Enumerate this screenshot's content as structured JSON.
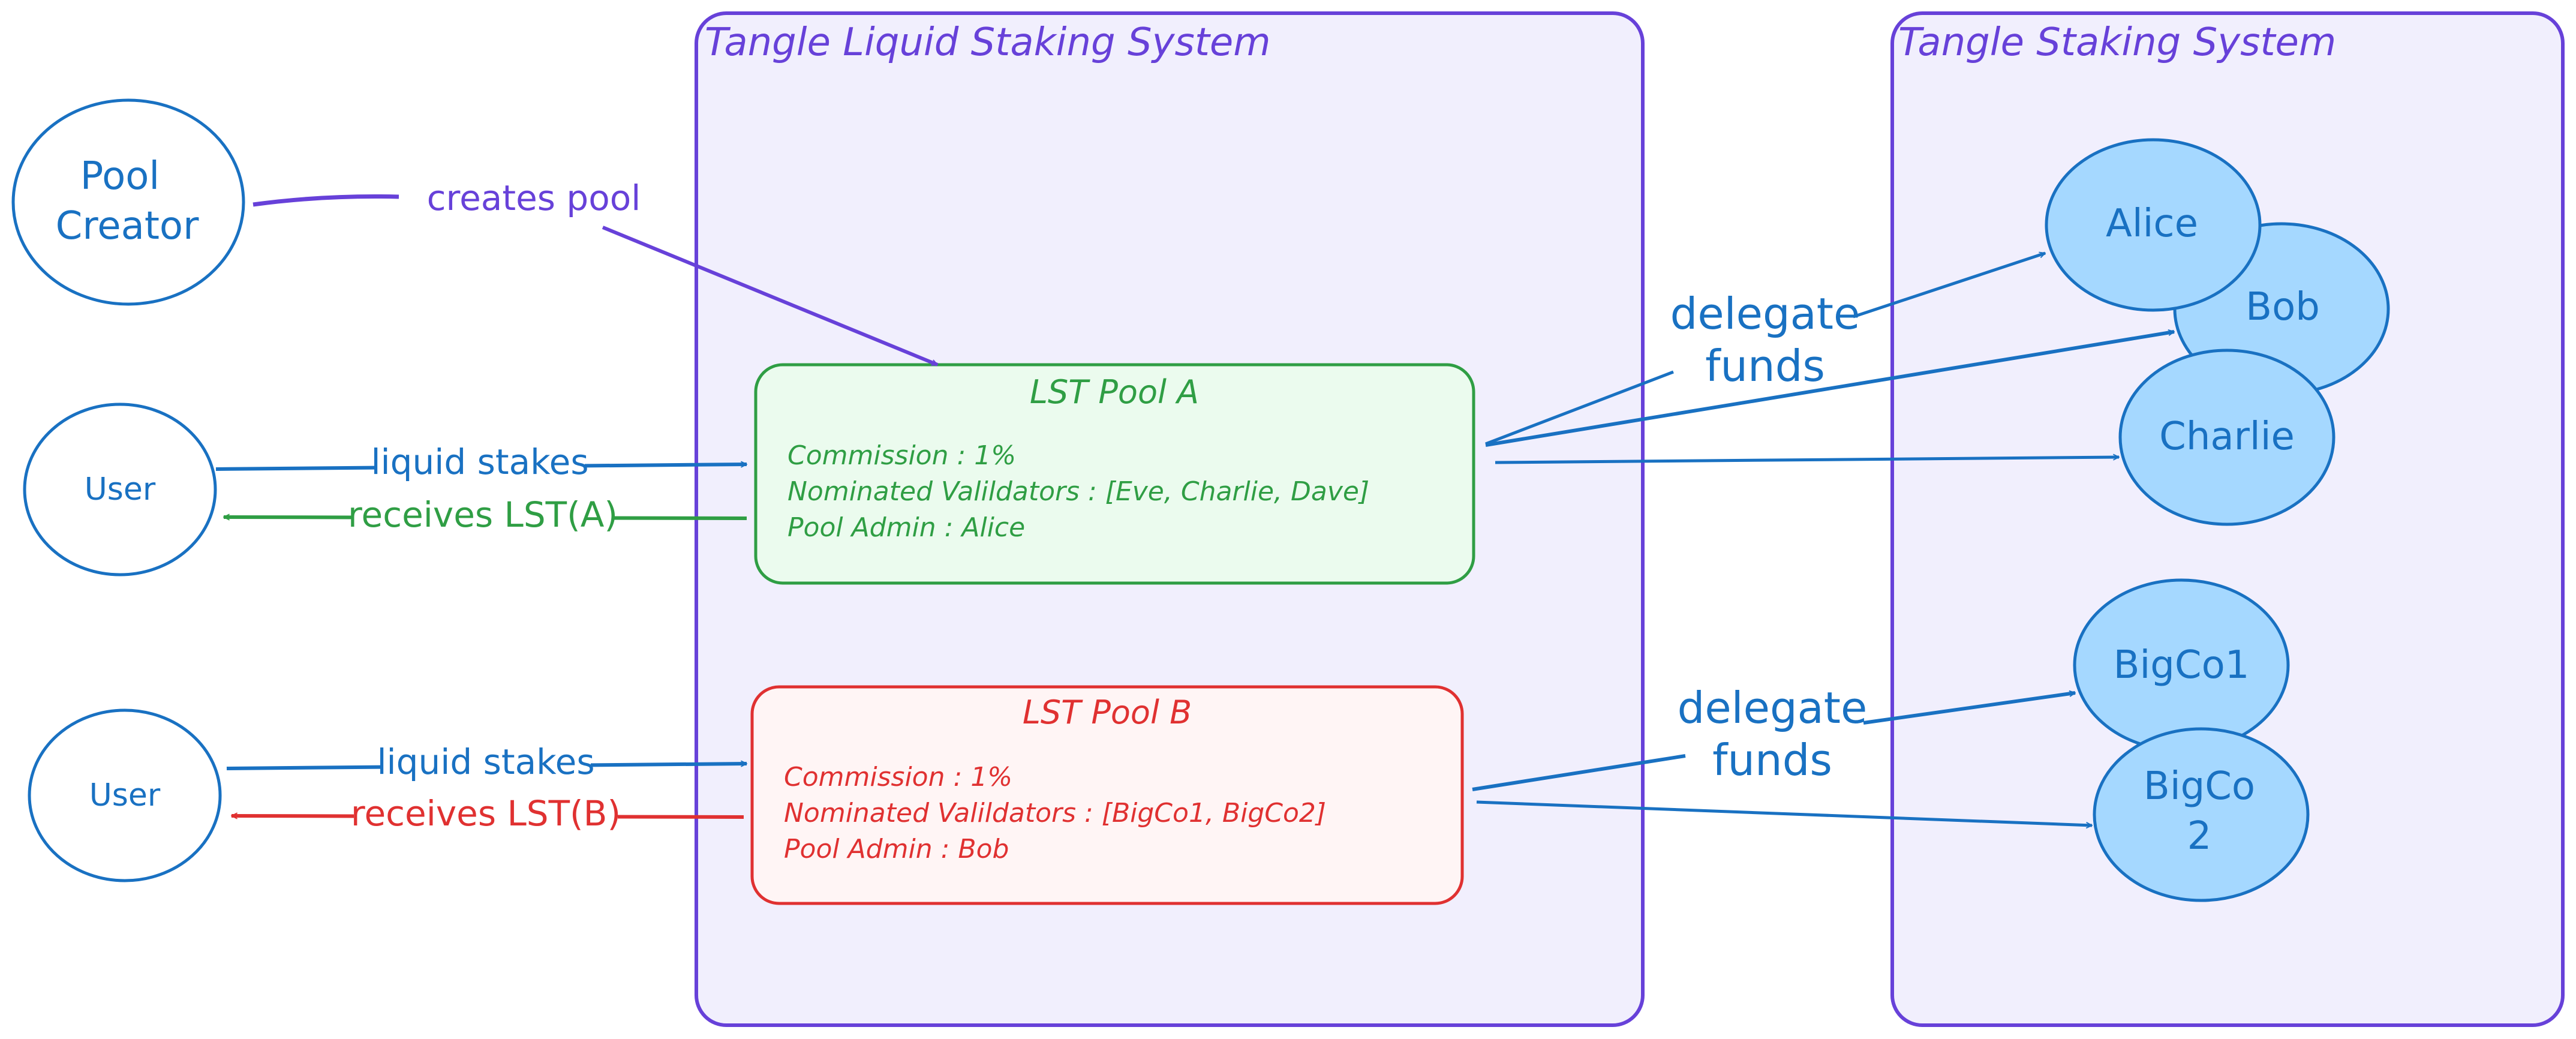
{
  "colors": {
    "system_stroke": "#6741d9",
    "system_fill": "#f1effd",
    "actor_stroke": "#1971c2",
    "validator_fill": "#a5d8ff",
    "pool_a_stroke": "#2f9e44",
    "pool_a_fill": "#ebfbee",
    "pool_b_stroke": "#e03131",
    "pool_b_fill": "#fff5f5",
    "create_arrow": "#6741d9"
  },
  "systems": {
    "liquid": {
      "title": "Tangle Liquid Staking System"
    },
    "staking": {
      "title": "Tangle Staking System"
    }
  },
  "actors": {
    "pool_creator": {
      "line1": "Pool",
      "line2": "Creator"
    },
    "user_a": {
      "label": "User"
    },
    "user_b": {
      "label": "User"
    }
  },
  "pools": [
    {
      "title": "LST Pool A",
      "commission": "Commission : 1%",
      "validators": "Nominated Valildators : [Eve, Charlie, Dave]",
      "admin": "Pool Admin : Alice"
    },
    {
      "title": "LST Pool B",
      "commission": "Commission : 1%",
      "validators": "Nominated Valildators : [BigCo1, BigCo2]",
      "admin": "Pool Admin : Bob"
    }
  ],
  "validators": {
    "alice": "Alice",
    "bob": "Bob",
    "charlie": "Charlie",
    "bigco1": "BigCo1",
    "bigco2_line1": "BigCo",
    "bigco2_line2": "2"
  },
  "edges": {
    "creates_pool": "creates pool",
    "liquid_stakes_a": "liquid stakes",
    "receives_a": "receives LST(A)",
    "liquid_stakes_b": "liquid stakes",
    "receives_b": "receives LST(B)",
    "delegate_a_line1": "delegate",
    "delegate_a_line2": "funds",
    "delegate_b_line1": "delegate",
    "delegate_b_line2": "funds"
  }
}
